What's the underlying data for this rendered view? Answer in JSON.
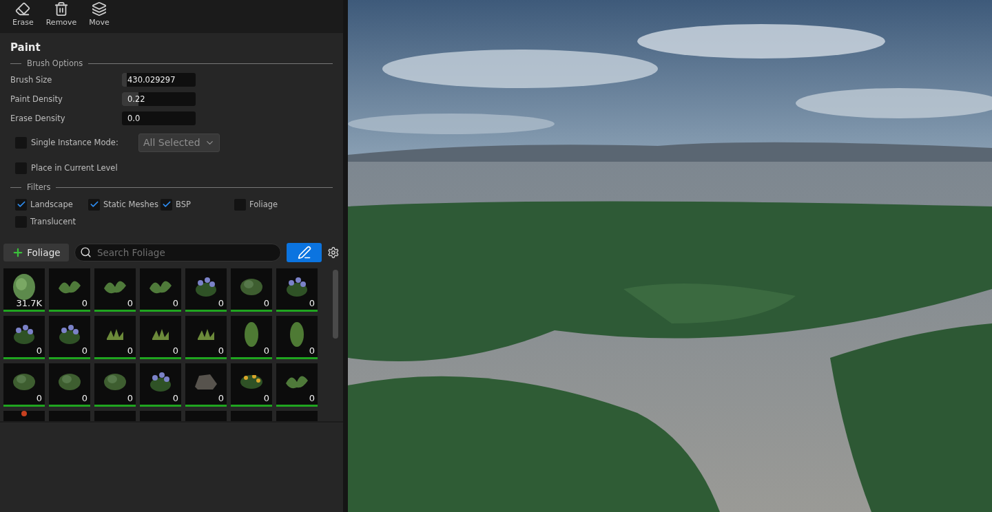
{
  "toolbar": [
    {
      "label": "Erase"
    },
    {
      "label": "Remove"
    },
    {
      "label": "Move"
    }
  ],
  "section_title": "Paint",
  "brush_options": {
    "title": "Brush Options",
    "fields": [
      {
        "label": "Brush Size",
        "value": "430.029297",
        "level": 0.07
      },
      {
        "label": "Paint Density",
        "value": "0.22",
        "level": 0.22
      },
      {
        "label": "Erase Density",
        "value": "0.0"
      }
    ],
    "single_instance": {
      "label": "Single Instance Mode:",
      "checked": false,
      "dropdown": "All Selected"
    },
    "place_in_level": {
      "label": "Place in Current Level",
      "checked": false
    }
  },
  "filters": {
    "title": "Filters",
    "items": [
      {
        "label": "Landscape",
        "checked": true
      },
      {
        "label": "Static Meshes",
        "checked": true
      },
      {
        "label": "BSP",
        "checked": true
      },
      {
        "label": "Foliage",
        "checked": false
      },
      {
        "label": "Translucent",
        "checked": false
      }
    ]
  },
  "foliage_bar": {
    "add_label": "Foliage",
    "search_placeholder": "Search Foliage",
    "paint_mode_selected": true
  },
  "foliage_items": [
    {
      "count": "31.7K",
      "active": true
    },
    {
      "count": "0",
      "active": true
    },
    {
      "count": "0",
      "active": true
    },
    {
      "count": "0",
      "active": true
    },
    {
      "count": "0",
      "active": true
    },
    {
      "count": "0",
      "active": true
    },
    {
      "count": "0",
      "active": true
    },
    {
      "count": "0",
      "active": true
    },
    {
      "count": "0",
      "active": true
    },
    {
      "count": "0",
      "active": true
    },
    {
      "count": "0",
      "active": true
    },
    {
      "count": "0",
      "active": true
    },
    {
      "count": "0",
      "active": true
    },
    {
      "count": "0",
      "active": true
    },
    {
      "count": "0",
      "active": true
    },
    {
      "count": "0",
      "active": true
    },
    {
      "count": "0",
      "active": true
    },
    {
      "count": "0",
      "active": true
    },
    {
      "count": "0",
      "active": true
    },
    {
      "count": "0",
      "active": true
    },
    {
      "count": "0",
      "active": true
    },
    {
      "kind": "clipped"
    },
    {
      "kind": "clipped"
    },
    {
      "kind": "clipped"
    },
    {
      "kind": "clipped"
    },
    {
      "kind": "clipped"
    },
    {
      "kind": "clipped"
    },
    {
      "kind": "clipped"
    }
  ]
}
